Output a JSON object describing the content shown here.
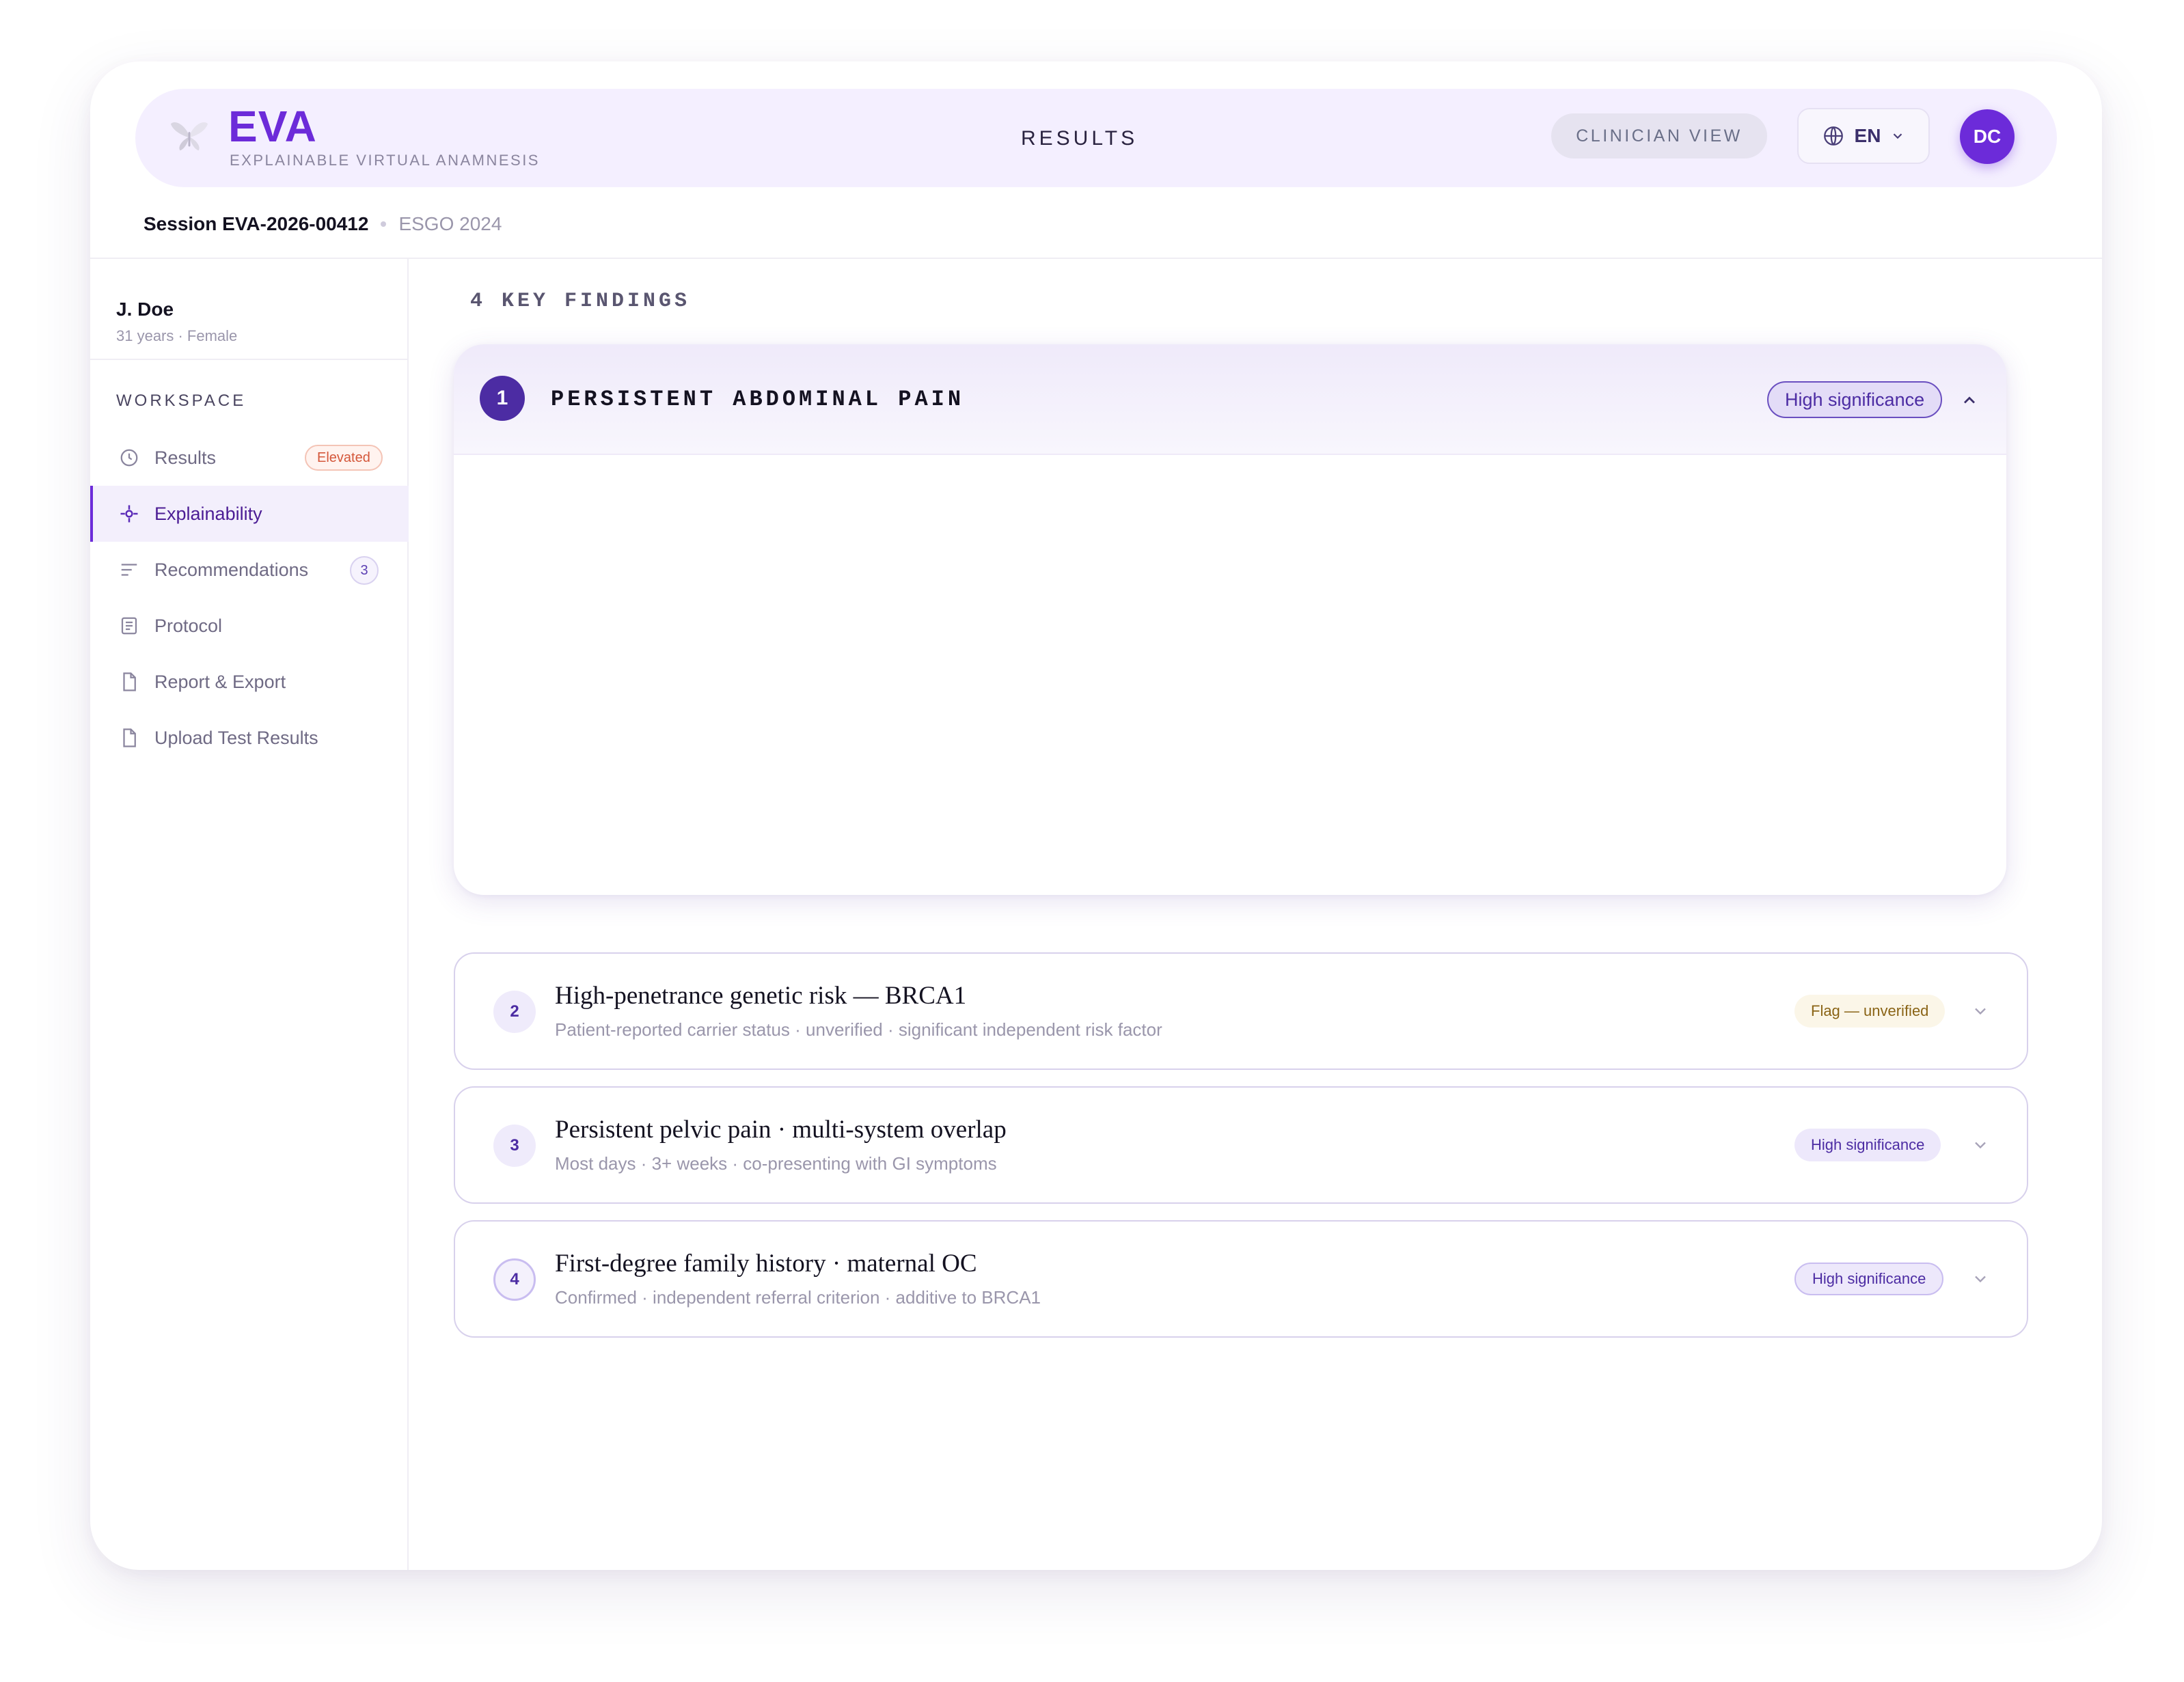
{
  "app": {
    "brand": "EVA",
    "brand_subtitle": "EXPLAINABLE VIRTUAL ANAMNESIS",
    "page_title": "RESULTS",
    "clinician_button": "CLINICIAN VIEW",
    "language": "EN",
    "avatar_initials": "DC",
    "accent_color": "#6c2bd9"
  },
  "session": {
    "id": "Session EVA-2026-00412",
    "guideline": "ESGO 2024"
  },
  "patient": {
    "name": "J. Doe",
    "meta": "31 years · Female"
  },
  "sidebar": {
    "section_label": "WORKSPACE",
    "items": [
      {
        "label": "Results",
        "icon": "clock-icon",
        "badge": "Elevated"
      },
      {
        "label": "Explainability",
        "icon": "sparkle-icon",
        "active": true
      },
      {
        "label": "Recommendations",
        "icon": "lines-icon",
        "count": "3"
      },
      {
        "label": "Protocol",
        "icon": "list-doc-icon"
      },
      {
        "label": "Report & Export",
        "icon": "file-icon"
      },
      {
        "label": "Upload Test Results",
        "icon": "file-icon"
      }
    ]
  },
  "findings": {
    "heading": "4 KEY FINDINGS",
    "expanded": {
      "number": "1",
      "title": "PERSISTENT ABDOMINAL PAIN",
      "badge": "High significance"
    },
    "items": [
      {
        "number": "2",
        "title": "High-penetrance genetic risk — BRCA1",
        "subtitle": "Patient-reported carrier status · unverified · significant independent risk factor",
        "badge": "Flag — unverified"
      },
      {
        "number": "3",
        "title": "Persistent pelvic pain · multi-system overlap",
        "subtitle": "Most days · 3+ weeks · co-presenting with GI symptoms",
        "badge": "High significance"
      },
      {
        "number": "4",
        "title": "First-degree family history · maternal OC",
        "subtitle": "Confirmed · independent referral criterion · additive to BRCA1",
        "badge": "High significance"
      }
    ]
  }
}
